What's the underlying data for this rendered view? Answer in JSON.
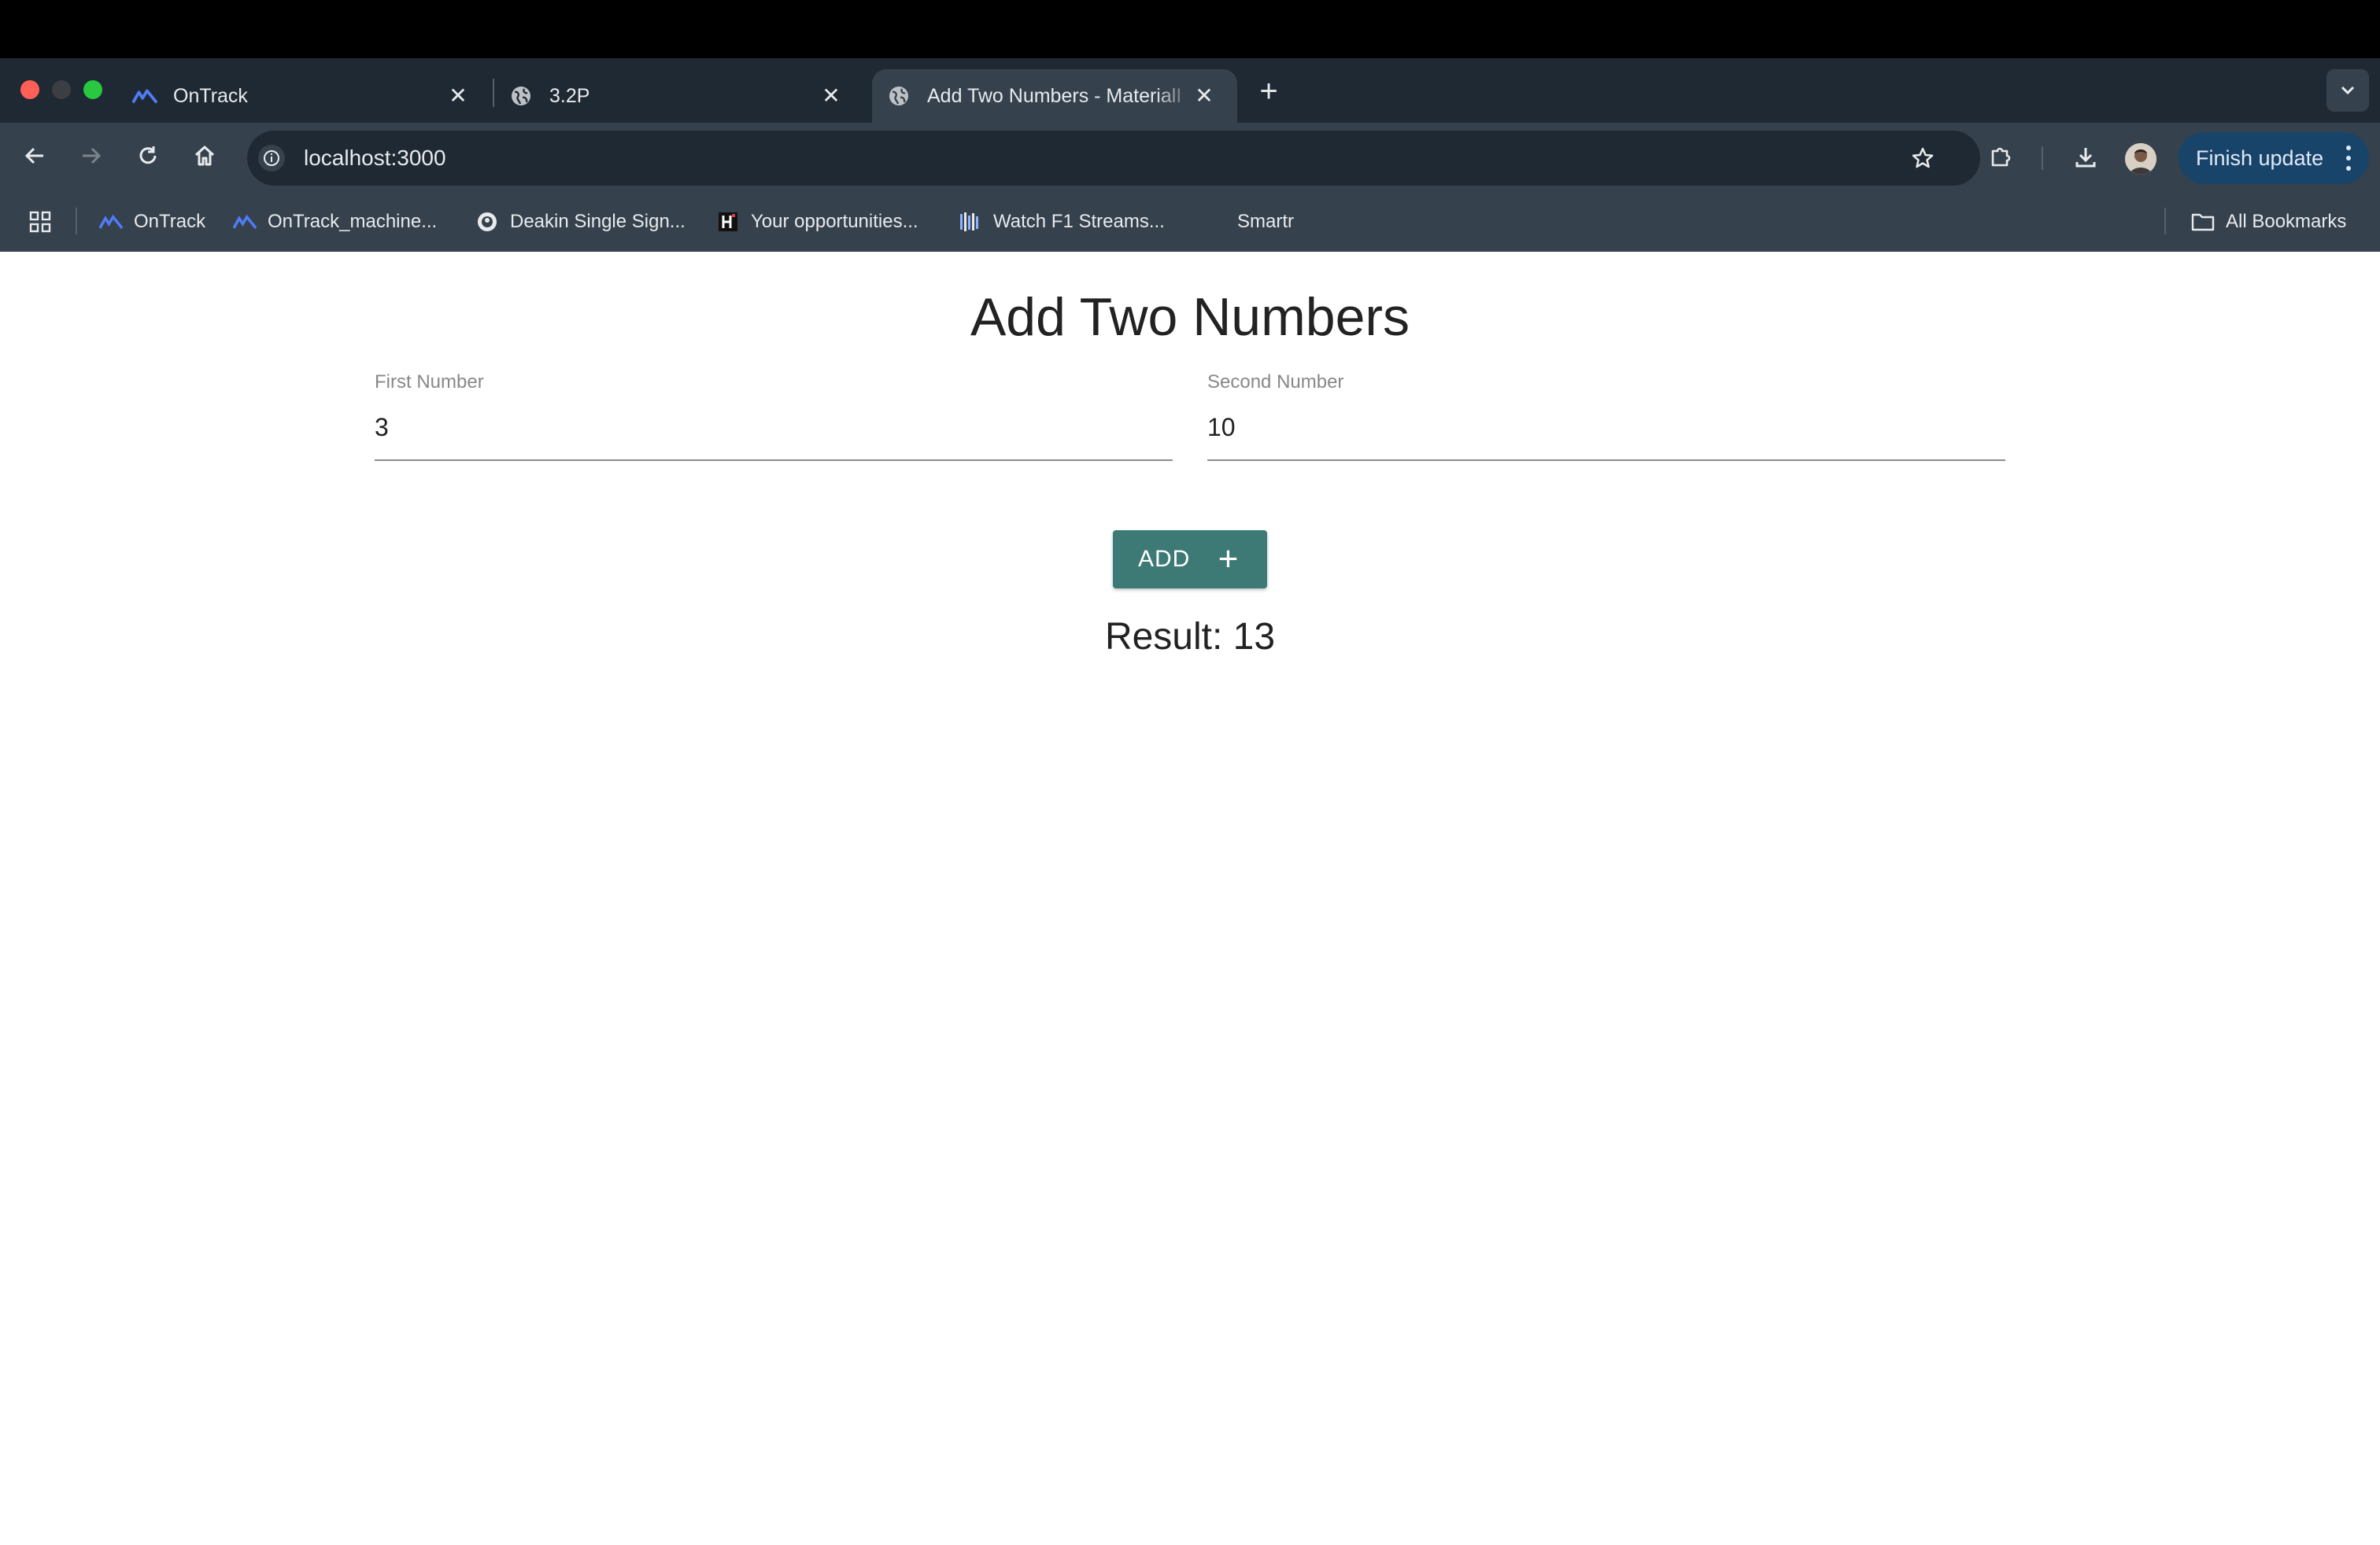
{
  "browser": {
    "tabs": [
      {
        "title": "OnTrack",
        "icon": "ontrack-logo-icon"
      },
      {
        "title": "3.2P",
        "icon": "globe-icon"
      },
      {
        "title": "Add Two Numbers - MaterialI",
        "icon": "globe-icon",
        "active": true
      }
    ],
    "address": "localhost:3000",
    "finish_update_label": "Finish update",
    "bookmarks": [
      {
        "label": "OnTrack"
      },
      {
        "label": "OnTrack_machine..."
      },
      {
        "label": "Deakin Single Sign..."
      },
      {
        "label": "Your opportunities..."
      },
      {
        "label": "Watch F1 Streams..."
      },
      {
        "label": "Smartr"
      }
    ],
    "all_bookmarks_label": "All Bookmarks"
  },
  "app": {
    "title": "Add Two Numbers",
    "first_field": {
      "label": "First Number",
      "value": "3"
    },
    "second_field": {
      "label": "Second Number",
      "value": "10"
    },
    "add_button_label": "ADD",
    "add_button_icon": "plus-icon",
    "result_label": "Result:",
    "result_value": "13"
  },
  "colors": {
    "button": "#3d7a75",
    "toolbar": "#35414c",
    "tabstrip": "#1f2933"
  }
}
